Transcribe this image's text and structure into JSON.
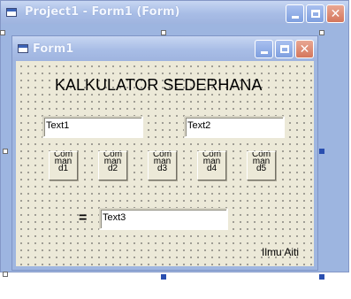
{
  "outer_window": {
    "title": "Project1 - Form1 (Form)"
  },
  "form_window": {
    "title": "Form1"
  },
  "form": {
    "heading": "KALKULATOR SEDERHANA",
    "text1": "Text1",
    "text2": "Text2",
    "text3": "Text3",
    "equals": "=",
    "footer": "Ilmu Aiti",
    "commands": [
      {
        "line1": "Com",
        "line2": "man",
        "line3": "d1"
      },
      {
        "line1": "Com",
        "line2": "man",
        "line3": "d2"
      },
      {
        "line1": "Com",
        "line2": "man",
        "line3": "d3"
      },
      {
        "line1": "Com",
        "line2": "man",
        "line3": "d4"
      },
      {
        "line1": "Com",
        "line2": "man",
        "line3": "d5"
      }
    ]
  },
  "colors": {
    "titlebar": "#a8bde6",
    "form_bg": "#ece9d8",
    "close_button": "#d4765c",
    "selection_handle": "#2a4fb0"
  }
}
